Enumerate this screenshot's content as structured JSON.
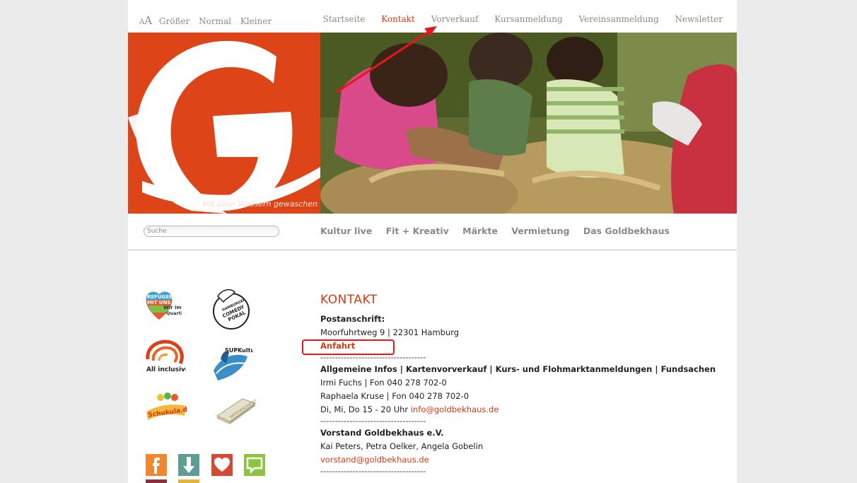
{
  "font_size": {
    "a_small": "A",
    "a_big": "A",
    "larger": "Größer",
    "normal": "Normal",
    "smaller": "Kleiner"
  },
  "top_nav": [
    "Startseite",
    "Kontakt",
    "Vorverkauf",
    "Kursanmeldung",
    "Vereinsanmeldung",
    "Newsletter"
  ],
  "banner": {
    "tagline": "Mit allen Wassern gewaschen"
  },
  "search": {
    "placeholder": "Suche"
  },
  "main_nav": [
    "Kultur live",
    "Fit + Kreativ",
    "Märkte",
    "Vermietung",
    "Das Goldbekhaus"
  ],
  "sidebar": {
    "logos": {
      "refugees": [
        "REFUGEES",
        "MIT UNS",
        "Wir im",
        "Quartier"
      ],
      "comedy": [
        "HAMBURGER",
        "COMEDY",
        "POKAL"
      ],
      "all_inclusive": "All inclusive",
      "sup": "SUPKultur",
      "schukula": "Schukula.de",
      "gold": "WERTGESCHÄTZT"
    },
    "social_icons": [
      "facebook-icon",
      "download-icon",
      "heart-icon",
      "chat-icon"
    ]
  },
  "contact": {
    "title": "KONTAKT",
    "postal_label": "Postanschrift:",
    "address": "Moorfuhrtweg 9 | 22301 Hamburg",
    "directions_link": "Anfahrt",
    "separator": "------------------------------------",
    "info_heading": "Allgemeine Infos | Kartenvorverkauf | Kurs- und Flohmarktanmeldungen | Fundsachen",
    "person1": "Irmi Fuchs | Fon 040 278 702-0",
    "person2": "Raphaela Kruse | Fon 040 278 702-0",
    "hours": "Di, Mi, Do 15 - 20 Uhr",
    "info_email": "info@goldbekhaus.de",
    "board_heading": "Vorstand Goldbekhaus e.V.",
    "board_members": "Kai Peters, Petra Oelker, Angela Gobelin",
    "board_email": "vorstand@goldbekhaus.de"
  },
  "colors": {
    "accent": "#d13c14",
    "logo_bg": "#dd4417",
    "annotation": "#e8161b"
  }
}
